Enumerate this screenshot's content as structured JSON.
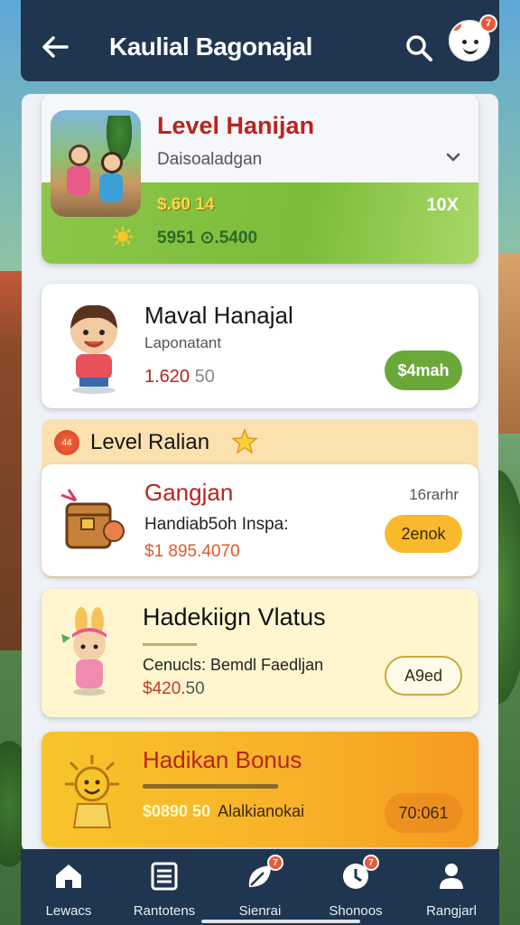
{
  "status_bar": "▪ ▪ ▪",
  "header": {
    "title": "Kaulial Bagonajal",
    "back_icon": "arrow-left-icon",
    "search_icon": "search-icon",
    "avatar_badge": "7"
  },
  "cards": [
    {
      "title": "Level Hanijan",
      "subtitle": "Daisoaladgan",
      "price_primary": "$.60 14",
      "price_secondary": "5951 ⊙.5400",
      "multiplier": "10X"
    },
    {
      "title": "Maval Hanajal",
      "subtitle": "Laponatant",
      "value_highlight": "1.620",
      "value_rest": " 50",
      "button": "$4mah"
    }
  ],
  "section": {
    "badge": "44",
    "title": "Level Ralian"
  },
  "offers": [
    {
      "title": "Gangjan",
      "note": "16rarhr",
      "subtitle": "Handiab5oh Inspa:",
      "value": "$1 895.4070",
      "button": "2enok"
    },
    {
      "title": "Hadekiign Vlatus",
      "subtitle": "Cenucls: Bemdl Faedljan",
      "value_highlight": "$420",
      "value_rest": ".50",
      "button": "A9ed"
    },
    {
      "title": "Hadikan Bonus",
      "value": "$0890 50",
      "value_note": "Alalkianokai",
      "button": "70:061"
    }
  ],
  "bottom_nav": [
    {
      "label": "Lewacs",
      "icon": "home-icon",
      "badge": ""
    },
    {
      "label": "Rantotens",
      "icon": "list-icon",
      "badge": ""
    },
    {
      "label": "Sienrai",
      "icon": "leaf-icon",
      "badge": "7"
    },
    {
      "label": "Shonoos",
      "icon": "clock-icon",
      "badge": "7"
    },
    {
      "label": "Rangjarl",
      "icon": "person-icon",
      "badge": ""
    }
  ]
}
